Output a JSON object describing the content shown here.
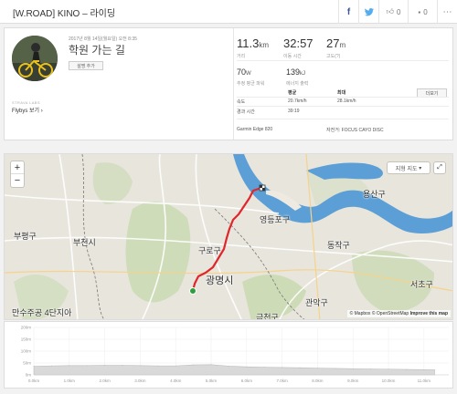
{
  "header": {
    "title": "[W.ROAD] KINO – 라이딩",
    "like_count": "0",
    "comment_count": "0"
  },
  "activity": {
    "date": "2017년 8월 14일(월요일) 오전 8:35",
    "title": "학원 가는 길",
    "add_description": "설명 추가",
    "device_label": "STRAVA LABS",
    "flyby_link": "Flybys 보기"
  },
  "stats": {
    "distance": {
      "value": "11.3",
      "unit": "km",
      "label": "거리"
    },
    "moving_time": {
      "value": "32:57",
      "label": "이동 시간"
    },
    "elevation": {
      "value": "27",
      "unit": "m",
      "label": "고도(?)"
    },
    "power": {
      "value": "70",
      "unit": "W",
      "label": "추정 평균 파워"
    },
    "energy": {
      "value": "139",
      "unit": "kJ",
      "label": "에너지 출력"
    }
  },
  "speed_table": {
    "col_avg": "평균",
    "col_max": "최대",
    "more_button": "더보기",
    "speed_label": "속도",
    "speed_avg": "20.7",
    "speed_max": "28.1",
    "speed_unit": "km/h",
    "elapsed_label": "경과 시간",
    "elapsed_value": "39:19"
  },
  "meta": {
    "device": "Garmin Edge 820",
    "bike_label": "자전거:",
    "bike_value": "FOCUS CAYO DISC"
  },
  "map": {
    "map_type": "지형 지도",
    "attribution_1": "© Mapbox",
    "attribution_2": "© OpenStreetMap",
    "attribution_3": "Improve this map",
    "labels": [
      "용산구",
      "영등포구",
      "동작구",
      "부평구",
      "부천시",
      "구로구",
      "광명시",
      "서초구",
      "관악구",
      "만수주공 4단지아",
      "금천구"
    ]
  },
  "colors": {
    "route": "#e0262b",
    "river": "#5b9fd6",
    "start": "#2e9e3f"
  },
  "chart_data": {
    "type": "area",
    "x": [
      0,
      0.5,
      1.0,
      1.5,
      2.0,
      2.5,
      3.0,
      3.5,
      4.0,
      4.5,
      5.0,
      5.5,
      6.0,
      6.5,
      7.0,
      7.5,
      8.0,
      8.5,
      9.0,
      9.5,
      10.0,
      10.5,
      11.0,
      11.3
    ],
    "values": [
      36,
      38,
      39,
      39,
      40,
      40,
      39,
      38,
      38,
      42,
      43,
      37,
      34,
      32,
      31,
      30,
      28,
      27,
      26,
      25,
      24,
      23,
      22,
      21
    ],
    "ylim": [
      0,
      200
    ],
    "x_ticks": [
      "0.0km",
      "1.0km",
      "2.0km",
      "3.0km",
      "4.0km",
      "5.0km",
      "6.0km",
      "7.0km",
      "8.0km",
      "9.0km",
      "10.0km",
      "11.0km"
    ],
    "y_ticks": [
      "200m",
      "150m",
      "100m",
      "50m",
      "0m"
    ],
    "grid": true
  }
}
